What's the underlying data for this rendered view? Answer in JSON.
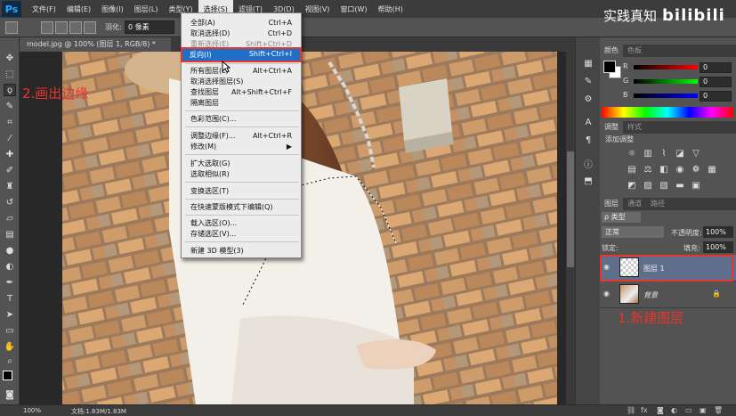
{
  "menubar": {
    "logo": "Ps",
    "items": [
      "文件(F)",
      "编辑(E)",
      "图像(I)",
      "图层(L)",
      "类型(Y)",
      "选择(S)",
      "滤镜(T)",
      "3D(D)",
      "视图(V)",
      "窗口(W)",
      "帮助(H)"
    ],
    "active_index": 5
  },
  "watermark": {
    "text": "实践真知",
    "brand": "bilibili"
  },
  "options": {
    "feather_label": "羽化:",
    "feather_value": "0 像素"
  },
  "document": {
    "tab_title": "model.jpg @ 100% (图层 1, RGB/8) *"
  },
  "annotations": {
    "step2": "2.画出边缘",
    "step1": "1.新建图层"
  },
  "select_menu": {
    "items": [
      {
        "label": "全部(A)",
        "shortcut": "Ctrl+A",
        "enabled": true
      },
      {
        "label": "取消选择(D)",
        "shortcut": "Ctrl+D",
        "enabled": true
      },
      {
        "label": "重新选择(E)",
        "shortcut": "Shift+Ctrl+D",
        "enabled": false
      },
      {
        "label": "反向(I)",
        "shortcut": "Shift+Ctrl+I",
        "enabled": true,
        "highlighted": true
      },
      {
        "label": "所有图层(L)",
        "shortcut": "Alt+Ctrl+A",
        "enabled": true
      },
      {
        "label": "取消选择图层(S)",
        "shortcut": "",
        "enabled": true
      },
      {
        "label": "查找图层",
        "shortcut": "Alt+Shift+Ctrl+F",
        "enabled": true
      },
      {
        "label": "隔离图层",
        "shortcut": "",
        "enabled": true
      },
      {
        "label": "色彩范围(C)...",
        "shortcut": "",
        "enabled": true
      },
      {
        "label": "调整边缘(F)...",
        "shortcut": "Alt+Ctrl+R",
        "enabled": true
      },
      {
        "label": "修改(M)",
        "shortcut": "▶",
        "enabled": true
      },
      {
        "label": "扩大选取(G)",
        "shortcut": "",
        "enabled": true
      },
      {
        "label": "选取相似(R)",
        "shortcut": "",
        "enabled": true
      },
      {
        "label": "变换选区(T)",
        "shortcut": "",
        "enabled": true
      },
      {
        "label": "在快速蒙版模式下编辑(Q)",
        "shortcut": "",
        "enabled": true
      },
      {
        "label": "载入选区(O)...",
        "shortcut": "",
        "enabled": true
      },
      {
        "label": "存储选区(V)...",
        "shortcut": "",
        "enabled": true
      },
      {
        "label": "新建 3D 模型(3)",
        "shortcut": "",
        "enabled": true
      }
    ]
  },
  "color_panel": {
    "tabs": [
      "颜色",
      "色板"
    ],
    "channels": [
      {
        "label": "R",
        "value": "0",
        "color": "#e02020"
      },
      {
        "label": "G",
        "value": "0",
        "color": "#20c020"
      },
      {
        "label": "B",
        "value": "0",
        "color": "#2060e0"
      }
    ]
  },
  "adjustments_panel": {
    "tabs": [
      "调整",
      "样式"
    ],
    "title": "添加调整"
  },
  "layers_panel": {
    "tabs": [
      "图层",
      "通道",
      "路径"
    ],
    "filter_label": "ρ 类型",
    "blend_mode": "正常",
    "opacity_label": "不透明度:",
    "opacity_value": "100%",
    "lock_label": "锁定:",
    "fill_label": "填充:",
    "fill_value": "100%",
    "layers": [
      {
        "name": "图层 1",
        "selected": true
      },
      {
        "name": "背景",
        "locked": true
      }
    ]
  },
  "status": {
    "zoom": "100%",
    "doc_info": "文档:1.83M/1.83M"
  },
  "colors": {
    "accent_red": "#e8352c",
    "menu_highlight": "#1e6fc8",
    "layer_selected": "#5e6f8c"
  }
}
